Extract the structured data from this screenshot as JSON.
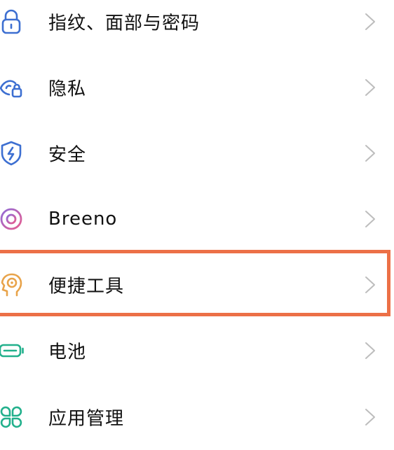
{
  "settings_list": {
    "items": [
      {
        "label": "指纹、面部与密码",
        "icon": "lock-icon",
        "color": "#3d6fd1"
      },
      {
        "label": "隐私",
        "icon": "privacy-eye-lock-icon",
        "color": "#3d6fd1"
      },
      {
        "label": "安全",
        "icon": "shield-bolt-icon",
        "color": "#3d6fd1"
      },
      {
        "label": "Breeno",
        "icon": "breeno-ring-icon",
        "color": "#d35fa3"
      },
      {
        "label": "便捷工具",
        "icon": "head-target-icon",
        "color": "#e8a34a"
      },
      {
        "label": "电池",
        "icon": "battery-icon",
        "color": "#22b08c"
      },
      {
        "label": "应用管理",
        "icon": "apps-grid-icon",
        "color": "#22b08c"
      }
    ]
  },
  "highlight": {
    "target": "便捷工具",
    "color": "#ec7047"
  },
  "chevron_color": "#bdbdbd"
}
